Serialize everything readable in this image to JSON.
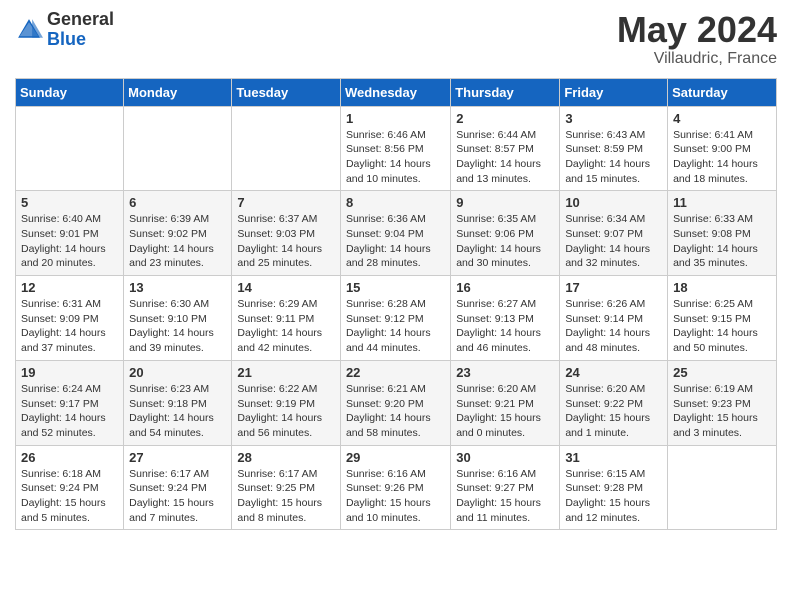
{
  "header": {
    "logo_general": "General",
    "logo_blue": "Blue",
    "month_year": "May 2024",
    "location": "Villaudric, France"
  },
  "days_of_week": [
    "Sunday",
    "Monday",
    "Tuesday",
    "Wednesday",
    "Thursday",
    "Friday",
    "Saturday"
  ],
  "weeks": [
    [
      {
        "day": "",
        "content": ""
      },
      {
        "day": "",
        "content": ""
      },
      {
        "day": "",
        "content": ""
      },
      {
        "day": "1",
        "content": "Sunrise: 6:46 AM\nSunset: 8:56 PM\nDaylight: 14 hours\nand 10 minutes."
      },
      {
        "day": "2",
        "content": "Sunrise: 6:44 AM\nSunset: 8:57 PM\nDaylight: 14 hours\nand 13 minutes."
      },
      {
        "day": "3",
        "content": "Sunrise: 6:43 AM\nSunset: 8:59 PM\nDaylight: 14 hours\nand 15 minutes."
      },
      {
        "day": "4",
        "content": "Sunrise: 6:41 AM\nSunset: 9:00 PM\nDaylight: 14 hours\nand 18 minutes."
      }
    ],
    [
      {
        "day": "5",
        "content": "Sunrise: 6:40 AM\nSunset: 9:01 PM\nDaylight: 14 hours\nand 20 minutes."
      },
      {
        "day": "6",
        "content": "Sunrise: 6:39 AM\nSunset: 9:02 PM\nDaylight: 14 hours\nand 23 minutes."
      },
      {
        "day": "7",
        "content": "Sunrise: 6:37 AM\nSunset: 9:03 PM\nDaylight: 14 hours\nand 25 minutes."
      },
      {
        "day": "8",
        "content": "Sunrise: 6:36 AM\nSunset: 9:04 PM\nDaylight: 14 hours\nand 28 minutes."
      },
      {
        "day": "9",
        "content": "Sunrise: 6:35 AM\nSunset: 9:06 PM\nDaylight: 14 hours\nand 30 minutes."
      },
      {
        "day": "10",
        "content": "Sunrise: 6:34 AM\nSunset: 9:07 PM\nDaylight: 14 hours\nand 32 minutes."
      },
      {
        "day": "11",
        "content": "Sunrise: 6:33 AM\nSunset: 9:08 PM\nDaylight: 14 hours\nand 35 minutes."
      }
    ],
    [
      {
        "day": "12",
        "content": "Sunrise: 6:31 AM\nSunset: 9:09 PM\nDaylight: 14 hours\nand 37 minutes."
      },
      {
        "day": "13",
        "content": "Sunrise: 6:30 AM\nSunset: 9:10 PM\nDaylight: 14 hours\nand 39 minutes."
      },
      {
        "day": "14",
        "content": "Sunrise: 6:29 AM\nSunset: 9:11 PM\nDaylight: 14 hours\nand 42 minutes."
      },
      {
        "day": "15",
        "content": "Sunrise: 6:28 AM\nSunset: 9:12 PM\nDaylight: 14 hours\nand 44 minutes."
      },
      {
        "day": "16",
        "content": "Sunrise: 6:27 AM\nSunset: 9:13 PM\nDaylight: 14 hours\nand 46 minutes."
      },
      {
        "day": "17",
        "content": "Sunrise: 6:26 AM\nSunset: 9:14 PM\nDaylight: 14 hours\nand 48 minutes."
      },
      {
        "day": "18",
        "content": "Sunrise: 6:25 AM\nSunset: 9:15 PM\nDaylight: 14 hours\nand 50 minutes."
      }
    ],
    [
      {
        "day": "19",
        "content": "Sunrise: 6:24 AM\nSunset: 9:17 PM\nDaylight: 14 hours\nand 52 minutes."
      },
      {
        "day": "20",
        "content": "Sunrise: 6:23 AM\nSunset: 9:18 PM\nDaylight: 14 hours\nand 54 minutes."
      },
      {
        "day": "21",
        "content": "Sunrise: 6:22 AM\nSunset: 9:19 PM\nDaylight: 14 hours\nand 56 minutes."
      },
      {
        "day": "22",
        "content": "Sunrise: 6:21 AM\nSunset: 9:20 PM\nDaylight: 14 hours\nand 58 minutes."
      },
      {
        "day": "23",
        "content": "Sunrise: 6:20 AM\nSunset: 9:21 PM\nDaylight: 15 hours\nand 0 minutes."
      },
      {
        "day": "24",
        "content": "Sunrise: 6:20 AM\nSunset: 9:22 PM\nDaylight: 15 hours\nand 1 minute."
      },
      {
        "day": "25",
        "content": "Sunrise: 6:19 AM\nSunset: 9:23 PM\nDaylight: 15 hours\nand 3 minutes."
      }
    ],
    [
      {
        "day": "26",
        "content": "Sunrise: 6:18 AM\nSunset: 9:24 PM\nDaylight: 15 hours\nand 5 minutes."
      },
      {
        "day": "27",
        "content": "Sunrise: 6:17 AM\nSunset: 9:24 PM\nDaylight: 15 hours\nand 7 minutes."
      },
      {
        "day": "28",
        "content": "Sunrise: 6:17 AM\nSunset: 9:25 PM\nDaylight: 15 hours\nand 8 minutes."
      },
      {
        "day": "29",
        "content": "Sunrise: 6:16 AM\nSunset: 9:26 PM\nDaylight: 15 hours\nand 10 minutes."
      },
      {
        "day": "30",
        "content": "Sunrise: 6:16 AM\nSunset: 9:27 PM\nDaylight: 15 hours\nand 11 minutes."
      },
      {
        "day": "31",
        "content": "Sunrise: 6:15 AM\nSunset: 9:28 PM\nDaylight: 15 hours\nand 12 minutes."
      },
      {
        "day": "",
        "content": ""
      }
    ]
  ]
}
